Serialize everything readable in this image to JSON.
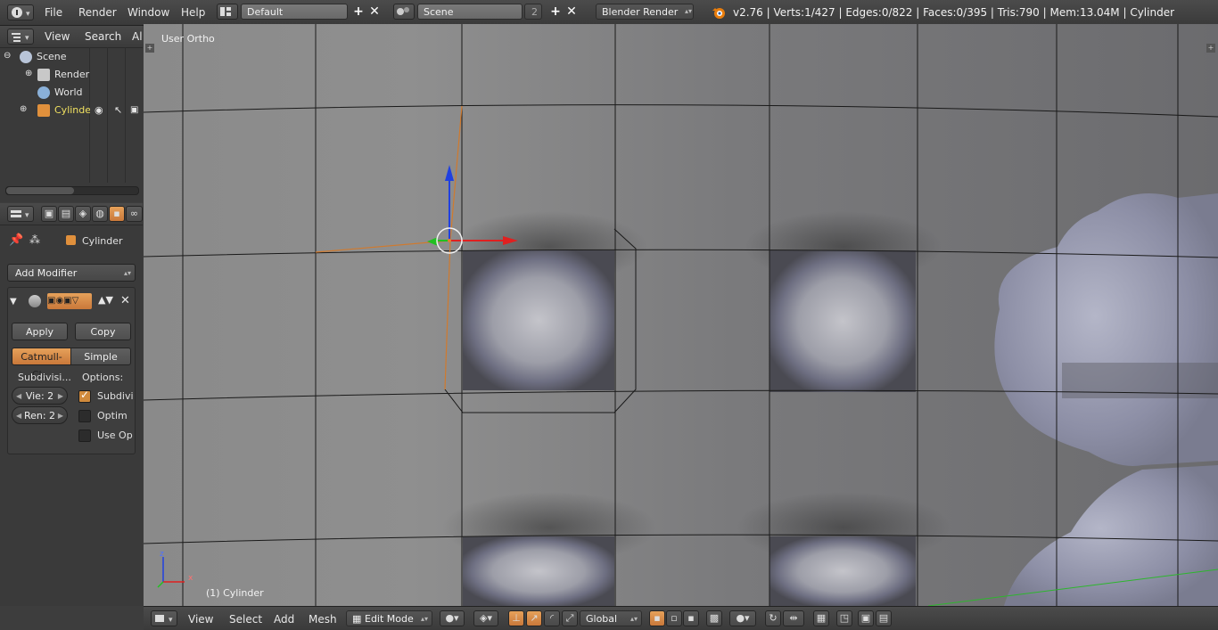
{
  "topbar": {
    "menus": [
      "File",
      "Render",
      "Window",
      "Help"
    ],
    "layout_name": "Default",
    "scene_name": "Scene",
    "scene_users": "2",
    "render_engine": "Blender Render",
    "stats": "v2.76 | Verts:1/427 | Edges:0/822 | Faces:0/395 | Tris:790 | Mem:13.04M | Cylinder"
  },
  "outliner": {
    "header_menus": [
      "View",
      "Search",
      "Al"
    ],
    "tree": [
      {
        "label": "Scene",
        "icon": "scene-icon"
      },
      {
        "label": "RenderL",
        "icon": "render-layers-icon"
      },
      {
        "label": "World",
        "icon": "world-icon"
      },
      {
        "label": "Cylinder",
        "icon": "mesh-object-icon"
      }
    ]
  },
  "properties": {
    "object_name": "Cylinder",
    "add_modifier": "Add Modifier",
    "apply_label": "Apply",
    "copy_label": "Copy",
    "catmull_label": "Catmull-Cl...",
    "simple_label": "Simple",
    "subdivisions_label": "Subdivisi...",
    "options_label": "Options:",
    "view_field": "Vie: 2",
    "render_field": "Ren: 2",
    "opt1_label": "Subdivi",
    "opt1_checked": true,
    "opt2_label": "Optim",
    "opt2_checked": false,
    "opt3_label": "Use Op",
    "opt3_checked": false
  },
  "viewport": {
    "view_label": "User Ortho",
    "object_label": "(1) Cylinder"
  },
  "bottombar": {
    "menus": [
      "View",
      "Select",
      "Add",
      "Mesh"
    ],
    "mode": "Edit Mode",
    "orientation": "Global"
  },
  "colors": {
    "accent": "#d08a3c",
    "axis_x": "#e02020",
    "axis_y": "#20c020",
    "axis_z": "#2040e0"
  }
}
